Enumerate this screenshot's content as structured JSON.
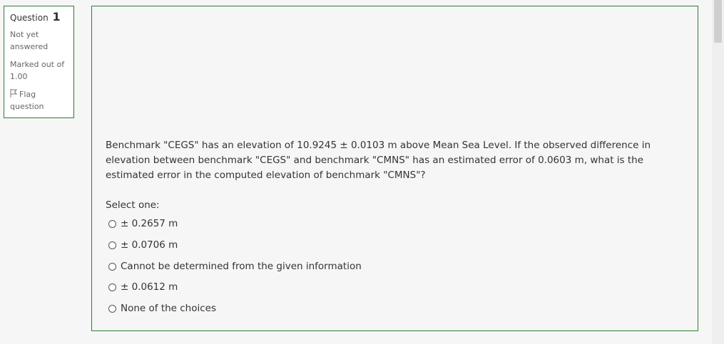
{
  "info": {
    "question_label": "Question",
    "question_number": "1",
    "status": "Not yet answered",
    "marks": "Marked out of 1.00",
    "flag_label": "Flag question"
  },
  "question": {
    "text": "Benchmark \"CEGS\" has an elevation of 10.9245 ± 0.0103 m above Mean Sea Level. If the observed difference in elevation between benchmark \"CEGS\" and benchmark \"CMNS\" has an estimated error of 0.0603 m, what is the estimated error in the computed elevation of benchmark \"CMNS\"?",
    "prompt": "Select one:",
    "options": [
      "± 0.2657 m",
      "± 0.0706 m",
      "Cannot be determined from the given information",
      "± 0.0612 m",
      "None of the choices"
    ]
  },
  "icons": {
    "flag": "flag-icon",
    "radio": "radio-icon"
  },
  "colors": {
    "border_accent": "#2e7d32"
  }
}
